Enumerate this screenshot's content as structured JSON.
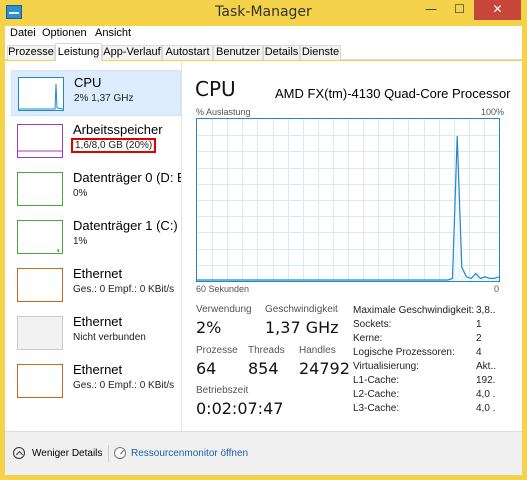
{
  "window": {
    "title": "Task-Manager",
    "minimize": "—",
    "maximize": "☐",
    "close": "✕"
  },
  "menu": [
    "Datei",
    "Optionen",
    "Ansicht"
  ],
  "tabs": [
    "Prozesse",
    "Leistung",
    "App-Verlauf",
    "Autostart",
    "Benutzer",
    "Details",
    "Dienste"
  ],
  "active_tab": "Leistung",
  "sidebar": [
    {
      "name": "CPU",
      "sub": "2% 1,37 GHz",
      "color": "#1f8ac7",
      "selected": true
    },
    {
      "name": "Arbeitsspeicher",
      "sub": "1,6/8,0 GB (20%)",
      "color": "#9b3db5",
      "highlighted": true,
      "highlight_color": "#e00000"
    },
    {
      "name": "Datenträger 0 (D: E",
      "sub": "0%",
      "color": "#4aa53a"
    },
    {
      "name": "Datenträger 1 (C:)",
      "sub": "1%",
      "color": "#4aa53a"
    },
    {
      "name": "Ethernet",
      "sub": "Ges.: 0  Empf.: 0 KBit/s",
      "color": "#c86a26"
    },
    {
      "name": "Ethernet",
      "sub": "Nicht verbunden",
      "color": "#b0b0b0",
      "disabled": true
    },
    {
      "name": "Ethernet",
      "sub": "Ges.: 0  Empf.: 0 KBit/s",
      "color": "#c86a26"
    }
  ],
  "main": {
    "title": "CPU",
    "model": "AMD FX(tm)-4130 Quad-Core Processor",
    "graph_label_left": "% Auslastung",
    "graph_label_right": "100%",
    "graph_bottom_left": "60 Sekunden",
    "graph_bottom_right": "0",
    "usage_label": "Verwendung",
    "usage_value": "2%",
    "speed_label": "Geschwindigkeit",
    "speed_value": "1,37 GHz",
    "processes_label": "Prozesse",
    "processes_value": "64",
    "threads_label": "Threads",
    "threads_value": "854",
    "handles_label": "Handles",
    "handles_value": "24792",
    "uptime_label": "Betriebszeit",
    "uptime_value": "0:02:07:47",
    "info": [
      {
        "label": "Maximale Geschwindigkeit:",
        "value": "3,8..."
      },
      {
        "label": "Sockets:",
        "value": "1"
      },
      {
        "label": "Kerne:",
        "value": "2"
      },
      {
        "label": "Logische Prozessoren:",
        "value": "4"
      },
      {
        "label": "Virtualisierung:",
        "value": "Akt..."
      },
      {
        "label": "L1-Cache:",
        "value": "192..."
      },
      {
        "label": "L2-Cache:",
        "value": "4,0 ..."
      },
      {
        "label": "L3-Cache:",
        "value": "4,0 ..."
      }
    ]
  },
  "cpu_history_percent": [
    0,
    0,
    0,
    0,
    0,
    0,
    0,
    0,
    0,
    0,
    0,
    0,
    0,
    0,
    0,
    0,
    0,
    0,
    0,
    0,
    0,
    0,
    0,
    0,
    0,
    0,
    0,
    0,
    0,
    0,
    0,
    0,
    0,
    0,
    0,
    0,
    0,
    0,
    0,
    0,
    0,
    0,
    0,
    0,
    0,
    0,
    0,
    0,
    0,
    0,
    0,
    0,
    0,
    0,
    0,
    1,
    90,
    8,
    2,
    1,
    4,
    1,
    2,
    1,
    1,
    2
  ],
  "footer": {
    "fewer_details": "Weniger Details",
    "resource_monitor": "Ressourcenmonitor öffnen"
  }
}
